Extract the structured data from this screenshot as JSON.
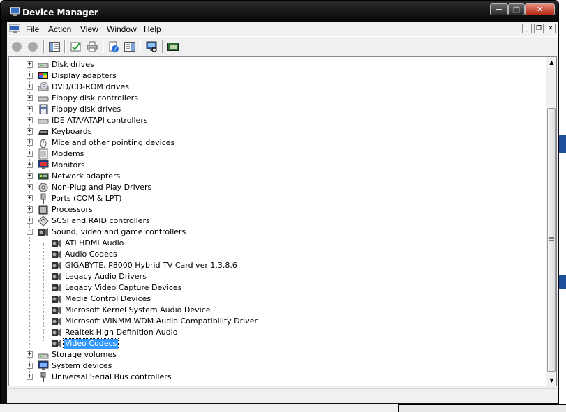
{
  "window": {
    "title": "Device Manager"
  },
  "menu": {
    "items": [
      "File",
      "Action",
      "View",
      "Window",
      "Help"
    ],
    "mdi_minimize": "_",
    "mdi_restore": "❐",
    "mdi_close": "✕"
  },
  "title_buttons": {
    "minimize": "—",
    "maximize": "□",
    "close": "✕"
  },
  "toolbar": {
    "icons": [
      "back-icon",
      "forward-icon",
      "show-hide-console-tree-icon",
      "properties-icon",
      "print-icon",
      "help-icon",
      "show-action-pane-icon",
      "scan-hardware-icon",
      "device-icon"
    ]
  },
  "tree": {
    "categories": [
      {
        "label": "Disk drives",
        "icon": "disk-drive-icon",
        "expanded": false
      },
      {
        "label": "Display adapters",
        "icon": "display-adapter-icon",
        "expanded": false
      },
      {
        "label": "DVD/CD-ROM drives",
        "icon": "dvd-drive-icon",
        "expanded": false
      },
      {
        "label": "Floppy disk controllers",
        "icon": "floppy-controller-icon",
        "expanded": false
      },
      {
        "label": "Floppy disk drives",
        "icon": "floppy-drive-icon",
        "expanded": false
      },
      {
        "label": "IDE ATA/ATAPI controllers",
        "icon": "ide-controller-icon",
        "expanded": false
      },
      {
        "label": "Keyboards",
        "icon": "keyboard-icon",
        "expanded": false
      },
      {
        "label": "Mice and other pointing devices",
        "icon": "mouse-icon",
        "expanded": false
      },
      {
        "label": "Modems",
        "icon": "modem-icon",
        "expanded": false
      },
      {
        "label": "Monitors",
        "icon": "monitor-icon",
        "expanded": false
      },
      {
        "label": "Network adapters",
        "icon": "network-adapter-icon",
        "expanded": false
      },
      {
        "label": "Non-Plug and Play Drivers",
        "icon": "non-pnp-driver-icon",
        "expanded": false
      },
      {
        "label": "Ports (COM & LPT)",
        "icon": "port-icon",
        "expanded": false
      },
      {
        "label": "Processors",
        "icon": "processor-icon",
        "expanded": false
      },
      {
        "label": "SCSI and RAID controllers",
        "icon": "scsi-icon",
        "expanded": false
      },
      {
        "label": "Sound, video and game controllers",
        "icon": "sound-video-icon",
        "expanded": true,
        "children": [
          {
            "label": "ATI HDMI Audio",
            "icon": "sound-device-icon"
          },
          {
            "label": "Audio Codecs",
            "icon": "sound-device-icon"
          },
          {
            "label": "GIGABYTE, P8000 Hybrid TV Card ver 1.3.8.6",
            "icon": "sound-device-icon"
          },
          {
            "label": "Legacy Audio Drivers",
            "icon": "sound-device-icon"
          },
          {
            "label": "Legacy Video Capture Devices",
            "icon": "sound-device-icon"
          },
          {
            "label": "Media Control Devices",
            "icon": "sound-device-icon"
          },
          {
            "label": "Microsoft Kernel System Audio Device",
            "icon": "sound-device-icon"
          },
          {
            "label": "Microsoft WINMM WDM Audio Compatibility Driver",
            "icon": "sound-device-icon"
          },
          {
            "label": "Realtek High Definition Audio",
            "icon": "sound-device-icon"
          },
          {
            "label": "Video Codecs",
            "icon": "sound-device-icon",
            "selected": true
          }
        ]
      },
      {
        "label": "Storage volumes",
        "icon": "storage-volume-icon",
        "expanded": false
      },
      {
        "label": "System devices",
        "icon": "system-device-icon",
        "expanded": false
      },
      {
        "label": "Universal Serial Bus controllers",
        "icon": "usb-icon",
        "expanded": false
      }
    ]
  },
  "colors": {
    "selection": "#3399ff",
    "titlebar": "#0e0e0e",
    "chrome": "#f0f0f0"
  }
}
